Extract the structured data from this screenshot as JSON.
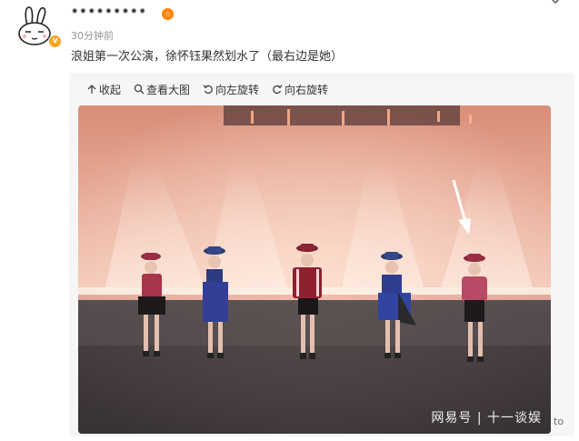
{
  "post": {
    "username": "•••••••••",
    "level_badge": "☆",
    "timestamp": "30分钟前",
    "text": "浪姐第一次公演，徐怀钰果然划水了（最右边是她）",
    "verified_mark": "v"
  },
  "toolbar": {
    "items": [
      {
        "icon": "collapse-icon",
        "label": "收起"
      },
      {
        "icon": "zoom-icon",
        "label": "查看大图"
      },
      {
        "icon": "rotate-left-icon",
        "label": "向左旋转"
      },
      {
        "icon": "rotate-right-icon",
        "label": "向右旋转"
      }
    ]
  },
  "photo": {
    "watermark": "网易号 | 十一谈娱",
    "suffix": "to"
  },
  "colors": {
    "accent": "#ff8200",
    "stage_glow": "#f2b09a",
    "stage_floor": "#3b3436"
  }
}
